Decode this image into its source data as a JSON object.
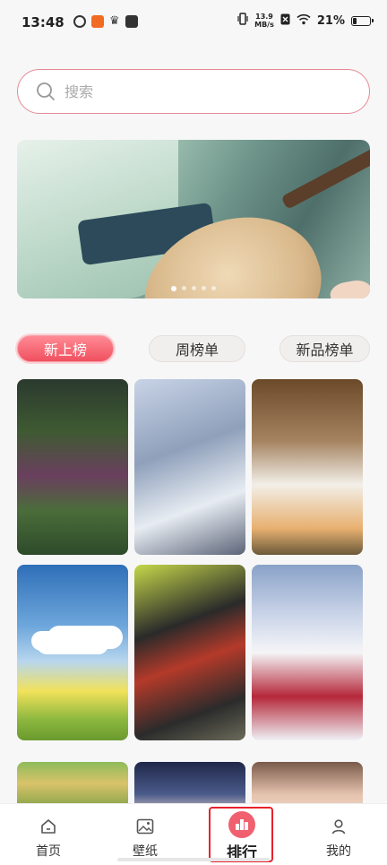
{
  "status_bar": {
    "time": "13:48",
    "net_speed_value": "13.9",
    "net_speed_unit": "MB/s",
    "battery": "21%"
  },
  "search": {
    "placeholder": "搜索"
  },
  "banner": {
    "dot_count": 5,
    "active_dot": 0
  },
  "tabs": [
    {
      "label": "新上榜",
      "active": true
    },
    {
      "label": "周榜单",
      "active": false
    },
    {
      "label": "新品榜单",
      "active": false
    }
  ],
  "wallpapers": [
    {
      "name": "pink-roses-street"
    },
    {
      "name": "anime-girl-white-hair"
    },
    {
      "name": "girl-with-flowers"
    },
    {
      "name": "blue-sky-field"
    },
    {
      "name": "red-hair-anime-girl"
    },
    {
      "name": "girl-snow-mountain"
    },
    {
      "name": "countryside-painting"
    },
    {
      "name": "dark-hair-girl"
    },
    {
      "name": "girl-portrait"
    }
  ],
  "bottom_nav": [
    {
      "label": "首页",
      "icon": "home-icon"
    },
    {
      "label": "壁纸",
      "icon": "image-icon"
    },
    {
      "label": "排行",
      "icon": "ranking-icon",
      "active": true
    },
    {
      "label": "我的",
      "icon": "user-icon"
    }
  ],
  "colors": {
    "accent": "#f0505f",
    "highlight": "#e8222c"
  }
}
